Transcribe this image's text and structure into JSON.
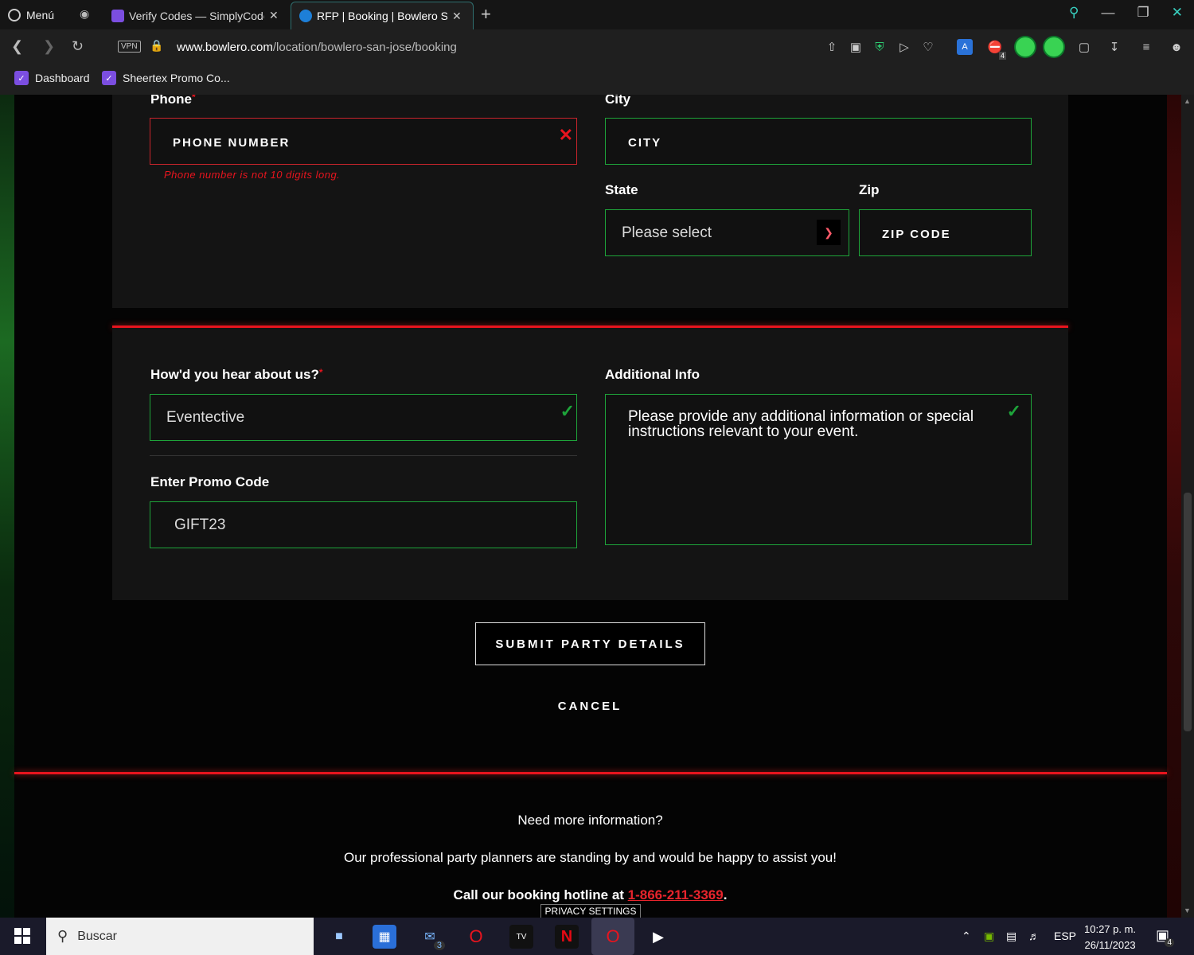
{
  "browser": {
    "menu_label": "Menú",
    "tabs": [
      {
        "title": "Verify Codes — SimplyCodes",
        "active": false
      },
      {
        "title": "RFP | Booking | Bowlero San Jose",
        "active": true
      }
    ],
    "vpn_label": "VPN",
    "url_domain": "www.bowlero.com",
    "url_path": "/location/bowlero-san-jose/booking",
    "bookmarks": [
      {
        "label": "Dashboard"
      },
      {
        "label": "Sheertex Promo Co..."
      }
    ],
    "ext_badges": {
      "ublock": "4"
    }
  },
  "form": {
    "phone": {
      "label": "Phone",
      "required_mark": "*",
      "placeholder": "PHONE NUMBER",
      "error": "Phone number is not 10 digits long."
    },
    "city": {
      "label": "City",
      "placeholder": "CITY"
    },
    "state": {
      "label": "State",
      "selected": "Please select"
    },
    "zip": {
      "label": "Zip",
      "placeholder": "ZIP CODE"
    },
    "hear": {
      "label": "How'd you hear about us?",
      "required_mark": "*",
      "value": "Eventective"
    },
    "additional": {
      "label": "Additional Info",
      "placeholder": "Please provide any additional information or special instructions relevant to your event."
    },
    "promo": {
      "label": "Enter Promo Code",
      "value": "GIFT23"
    },
    "submit_label": "SUBMIT PARTY DETAILS",
    "cancel_label": "CANCEL"
  },
  "footer": {
    "line1": "Need more information?",
    "line2": "Our professional party planners are standing by and would be happy to assist you!",
    "hotline_prefix": "Call our booking hotline at ",
    "hotline_number": "1-866-211-3369",
    "hotline_suffix": ".",
    "privacy": "PRIVACY SETTINGS"
  },
  "taskbar": {
    "search_label": "Buscar",
    "mail_badge": "3",
    "lang": "ESP",
    "time": "10:27 p. m.",
    "date": "26/11/2023",
    "notif_badge": "4"
  },
  "colors": {
    "accent_green": "#1ea43a",
    "accent_red": "#e8141e"
  }
}
